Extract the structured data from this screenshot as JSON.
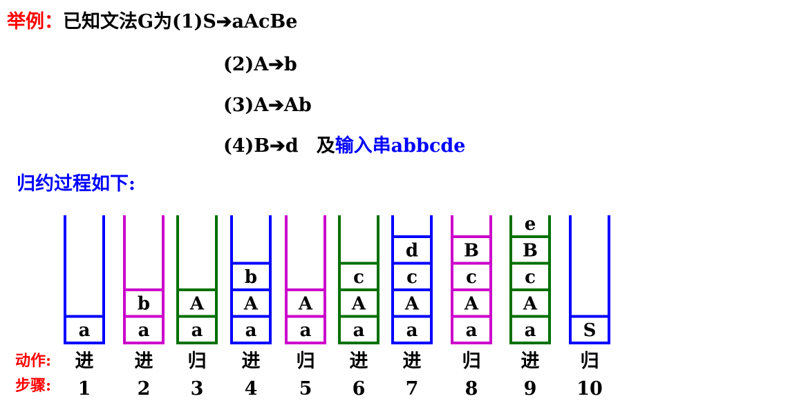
{
  "header": {
    "example_label": "举例：",
    "intro": "已知文法G为(1)S",
    "rule1_rhs": "aAcBe",
    "rule2_lhs": "(2)A",
    "rule2_rhs": "b",
    "rule3_lhs": "(3)A",
    "rule3_rhs": "Ab",
    "rule4_lhs": "(4)B",
    "rule4_rhs": "d",
    "input_prefix": "及",
    "input_label": "输入串abbcde",
    "process_title": "归约过程如下:"
  },
  "labels": {
    "action": "动作:",
    "step": "步骤:"
  },
  "colors": {
    "blue": "#0000ff",
    "magenta": "#cc00cc",
    "green": "#007000",
    "red": "#ff0000"
  },
  "stacks": [
    {
      "step": "1",
      "action": "进",
      "color": "blue",
      "cells": [
        "a"
      ]
    },
    {
      "step": "2",
      "action": "进",
      "color": "magenta",
      "cells": [
        "a",
        "b"
      ]
    },
    {
      "step": "3",
      "action": "归",
      "color": "green",
      "cells": [
        "a",
        "A"
      ]
    },
    {
      "step": "4",
      "action": "进",
      "color": "blue",
      "cells": [
        "a",
        "A",
        "b"
      ]
    },
    {
      "step": "5",
      "action": "归",
      "color": "magenta",
      "cells": [
        "a",
        "A"
      ]
    },
    {
      "step": "6",
      "action": "进",
      "color": "green",
      "cells": [
        "a",
        "A",
        "c"
      ]
    },
    {
      "step": "7",
      "action": "进",
      "color": "blue",
      "cells": [
        "a",
        "A",
        "c",
        "d"
      ]
    },
    {
      "step": "8",
      "action": "归",
      "color": "magenta",
      "cells": [
        "a",
        "A",
        "c",
        "B"
      ]
    },
    {
      "step": "9",
      "action": "进",
      "color": "green",
      "cells": [
        "a",
        "A",
        "c",
        "B",
        "e"
      ]
    },
    {
      "step": "10",
      "action": "归",
      "color": "blue",
      "cells": [
        "S"
      ]
    }
  ]
}
